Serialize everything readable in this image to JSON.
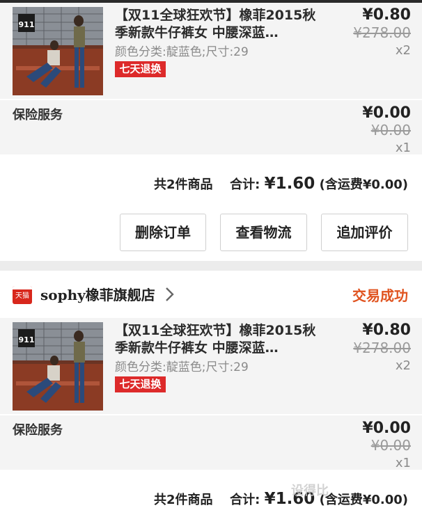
{
  "order1": {
    "item": {
      "title": "【双11全球狂欢节】橡菲2015秋季新款牛仔裤女 中腰深蓝…",
      "spec": "颜色分类:靛蓝色;尺寸:29",
      "tag": "七天退换",
      "price": "¥0.80",
      "original_price": "¥278.00",
      "quantity": "x2"
    },
    "insurance": {
      "label": "保险服务",
      "price": "¥0.00",
      "original_price": "¥0.00",
      "quantity": "x1"
    },
    "summary": {
      "count_text": "共2件商品",
      "total_label": "合计:",
      "total_value": "¥1.60",
      "shipping_text": "(含运费¥0.00)"
    },
    "buttons": {
      "delete": "删除订单",
      "logistics": "查看物流",
      "review": "追加评价"
    }
  },
  "order2": {
    "shop": {
      "icon_text": "天猫",
      "name": "sophy橡菲旗舰店",
      "status": "交易成功"
    },
    "item": {
      "title": "【双11全球狂欢节】橡菲2015秋季新款牛仔裤女 中腰深蓝…",
      "spec": "颜色分类:靛蓝色;尺寸:29",
      "tag": "七天退换",
      "price": "¥0.80",
      "original_price": "¥278.00",
      "quantity": "x2"
    },
    "insurance": {
      "label": "保险服务",
      "price": "¥0.00",
      "original_price": "¥0.00",
      "quantity": "x1"
    },
    "summary": {
      "count_text": "共2件商品",
      "total_label": "合计:",
      "total_value": "¥1.60",
      "shipping_text": "(含运费¥0.00)"
    }
  },
  "watermark": "设得比",
  "icons": {
    "thumbnail_1": "product-photo-icon",
    "thumbnail_2": "product-photo-icon",
    "shop": "tmall-cat-icon",
    "chevron": "chevron-right-icon"
  },
  "colors": {
    "tag_red": "#dd2a2a",
    "status_orange": "#e0531f",
    "row_gray": "#f4f4f4"
  }
}
